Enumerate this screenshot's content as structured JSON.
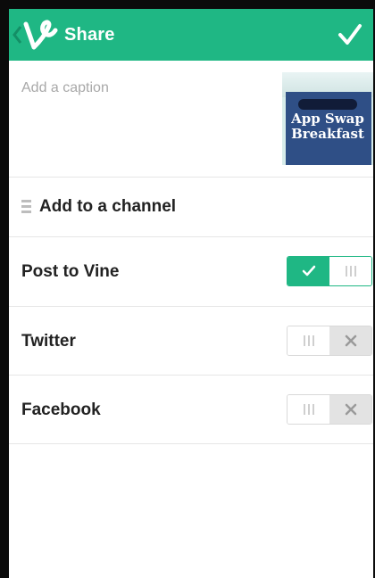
{
  "header": {
    "title": "Share",
    "back_icon": "chevron-left-icon",
    "logo_icon": "vine-logo-icon",
    "confirm_icon": "checkmark-icon",
    "accent_color": "#1fb784"
  },
  "caption": {
    "placeholder": "Add a caption",
    "value": ""
  },
  "thumbnail": {
    "text_line1": "App Swap",
    "text_line2": "Breakfast"
  },
  "channel": {
    "label": "Add to a channel",
    "icon": "drag-handle-icon"
  },
  "share_options": [
    {
      "label": "Post to Vine",
      "enabled": true,
      "on_icon": "checkmark-icon"
    },
    {
      "label": "Twitter",
      "enabled": false,
      "off_icon": "close-icon"
    },
    {
      "label": "Facebook",
      "enabled": false,
      "off_icon": "close-icon"
    }
  ]
}
